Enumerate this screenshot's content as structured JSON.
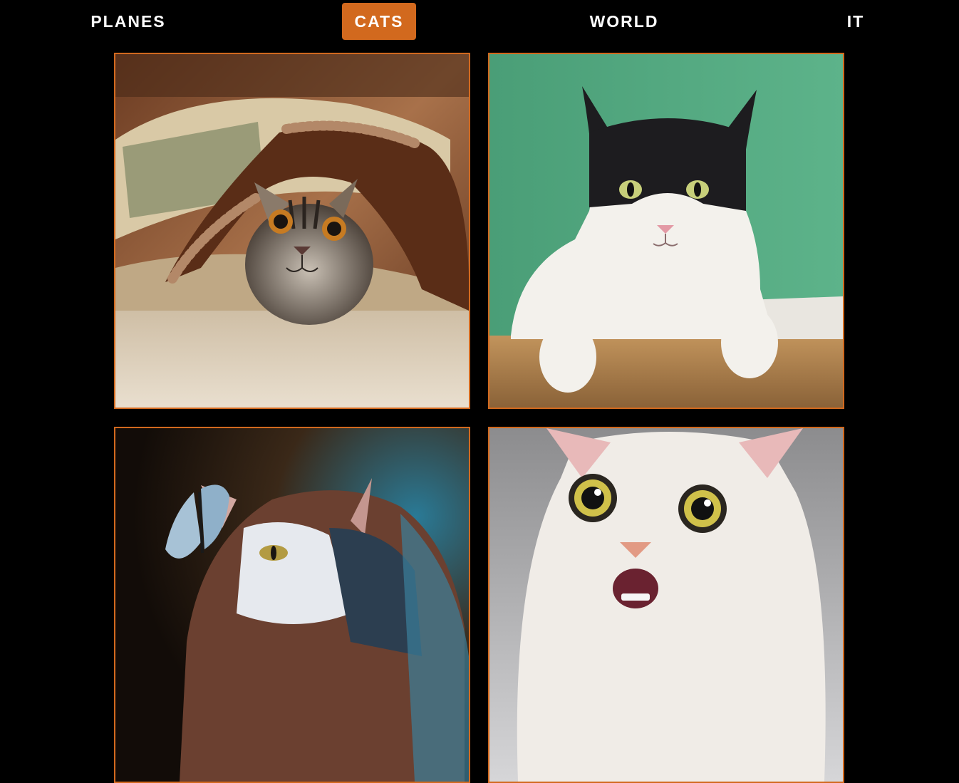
{
  "nav": {
    "items": [
      {
        "label": "PLANES",
        "active": false
      },
      {
        "label": "CATS",
        "active": true
      },
      {
        "label": "WORLD",
        "active": false
      },
      {
        "label": "IT",
        "active": false
      }
    ],
    "accent_color": "#d2691e"
  },
  "gallery": {
    "category": "CATS",
    "tiles": [
      {
        "subject": "tabby kitten under fringed blanket"
      },
      {
        "subject": "black and white cat against green wall"
      },
      {
        "subject": "cat with butterfly on nose"
      },
      {
        "subject": "white cat with wide eyes, mouth open"
      }
    ]
  }
}
